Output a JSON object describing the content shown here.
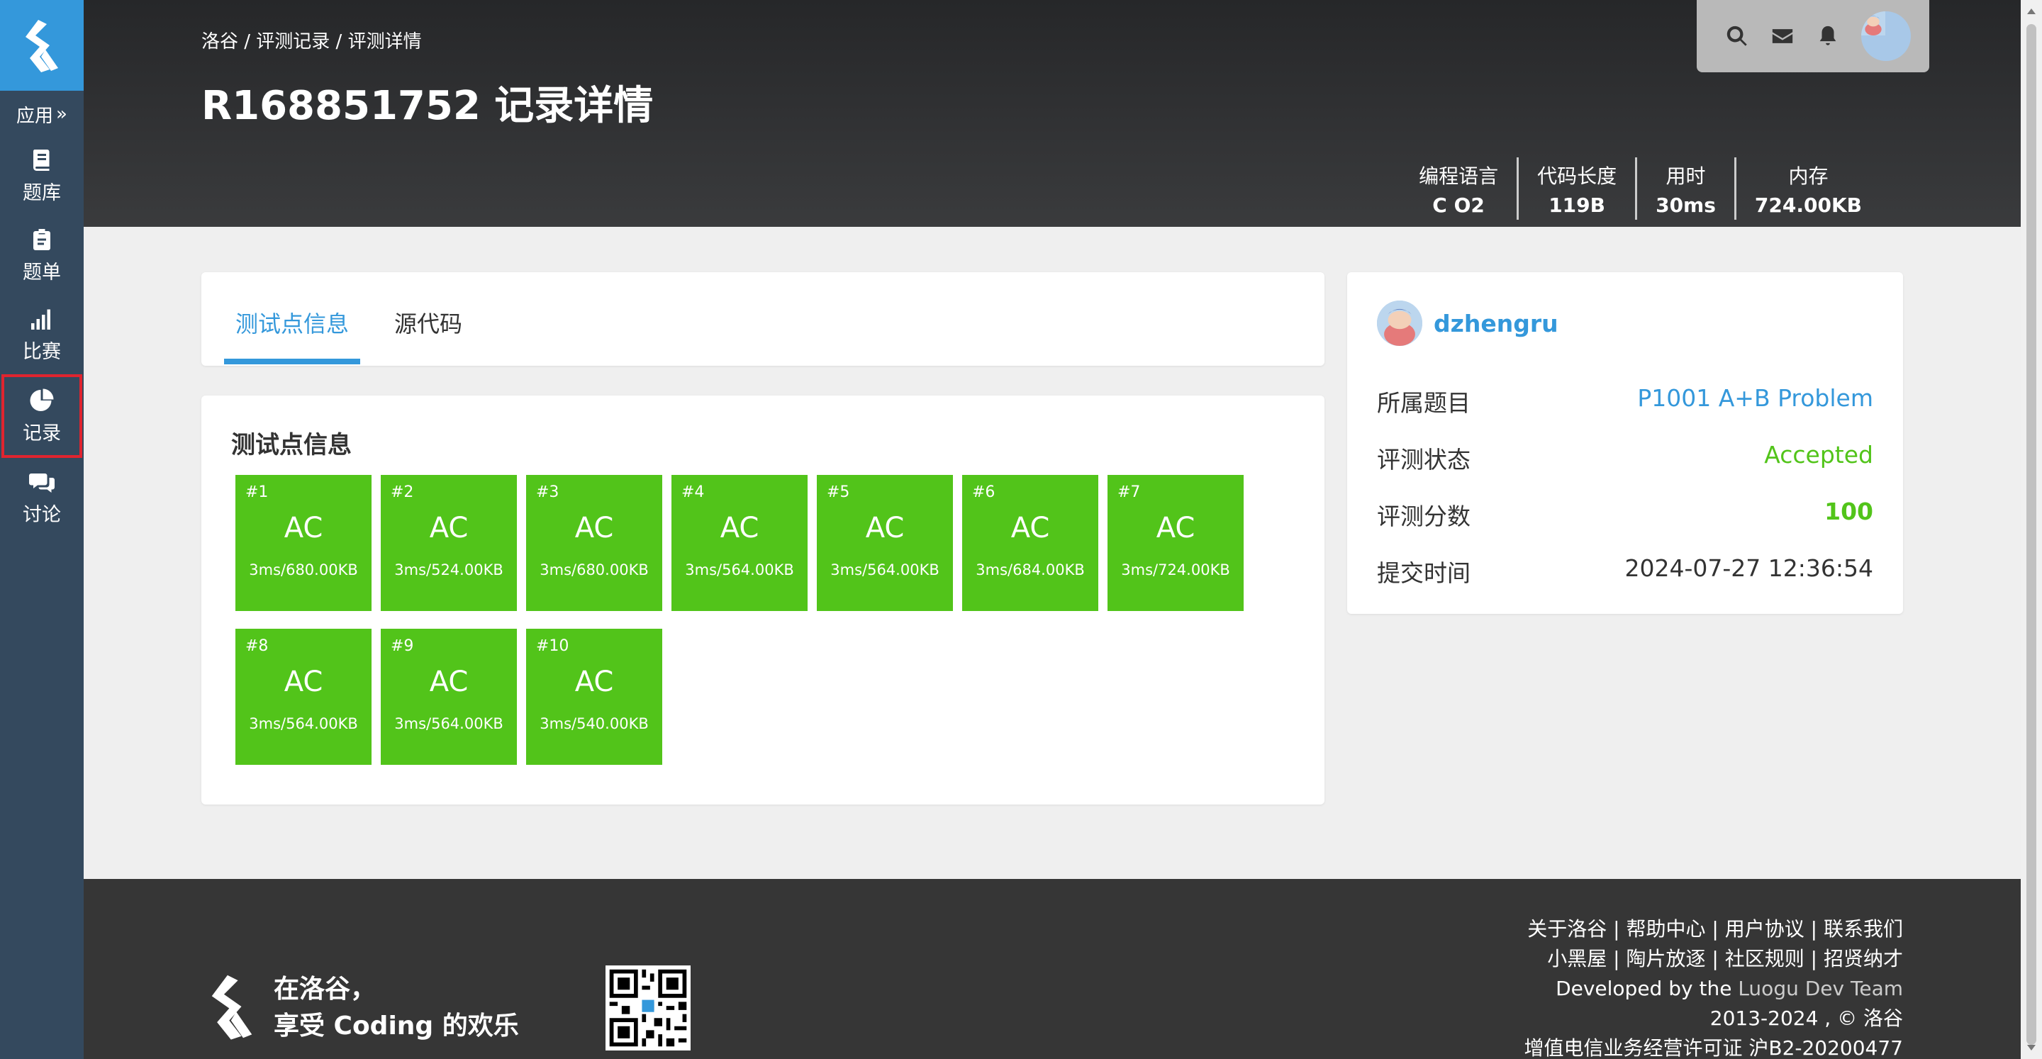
{
  "sidebar": {
    "apps_label": "应用",
    "items": [
      {
        "label": "题库",
        "icon": "book-icon"
      },
      {
        "label": "题单",
        "icon": "clipboard-icon"
      },
      {
        "label": "比赛",
        "icon": "signal-bars-icon"
      },
      {
        "label": "记录",
        "icon": "pie-chart-icon",
        "active": true
      },
      {
        "label": "讨论",
        "icon": "chat-bubbles-icon"
      }
    ]
  },
  "header": {
    "breadcrumb": "洛谷 / 评测记录 / 评测详情",
    "title": "R168851752 记录详情",
    "stats": [
      {
        "label": "编程语言",
        "value": "C O2"
      },
      {
        "label": "代码长度",
        "value": "119B"
      },
      {
        "label": "用时",
        "value": "30ms"
      },
      {
        "label": "内存",
        "value": "724.00KB"
      }
    ]
  },
  "tabs": {
    "active": "测试点信息",
    "second": "源代码"
  },
  "testcases": {
    "title": "测试点信息",
    "items": [
      {
        "idx": "#1",
        "status": "AC",
        "info": "3ms/680.00KB"
      },
      {
        "idx": "#2",
        "status": "AC",
        "info": "3ms/524.00KB"
      },
      {
        "idx": "#3",
        "status": "AC",
        "info": "3ms/680.00KB"
      },
      {
        "idx": "#4",
        "status": "AC",
        "info": "3ms/564.00KB"
      },
      {
        "idx": "#5",
        "status": "AC",
        "info": "3ms/564.00KB"
      },
      {
        "idx": "#6",
        "status": "AC",
        "info": "3ms/684.00KB"
      },
      {
        "idx": "#7",
        "status": "AC",
        "info": "3ms/724.00KB"
      },
      {
        "idx": "#8",
        "status": "AC",
        "info": "3ms/564.00KB"
      },
      {
        "idx": "#9",
        "status": "AC",
        "info": "3ms/564.00KB"
      },
      {
        "idx": "#10",
        "status": "AC",
        "info": "3ms/540.00KB"
      }
    ]
  },
  "info": {
    "username": "dzhengru",
    "problem_label": "所属题目",
    "problem_value": "P1001 A+B Problem",
    "status_label": "评测状态",
    "status_value": "Accepted",
    "score_label": "评测分数",
    "score_value": "100",
    "time_label": "提交时间",
    "time_value": "2024-07-27 12:36:54"
  },
  "footer": {
    "slogan_line1": "在洛谷，",
    "slogan_line2": "享受 Coding 的欢乐",
    "links_line1": "关于洛谷 | 帮助中心 | 用户协议 | 联系我们",
    "links_line2": "小黑屋 | 陶片放逐 | 社区规则 | 招贤纳才",
    "dev_prefix": "Developed by the ",
    "dev_team": "Luogu Dev Team",
    "copyright": "2013-2024 , © 洛谷",
    "license": "增值电信业务经营许可证 沪B2-20200477"
  },
  "colors": {
    "accent": "#3498db",
    "sidebar": "#34495e",
    "ac_green": "#52c41a",
    "active_border": "#e0242f"
  }
}
